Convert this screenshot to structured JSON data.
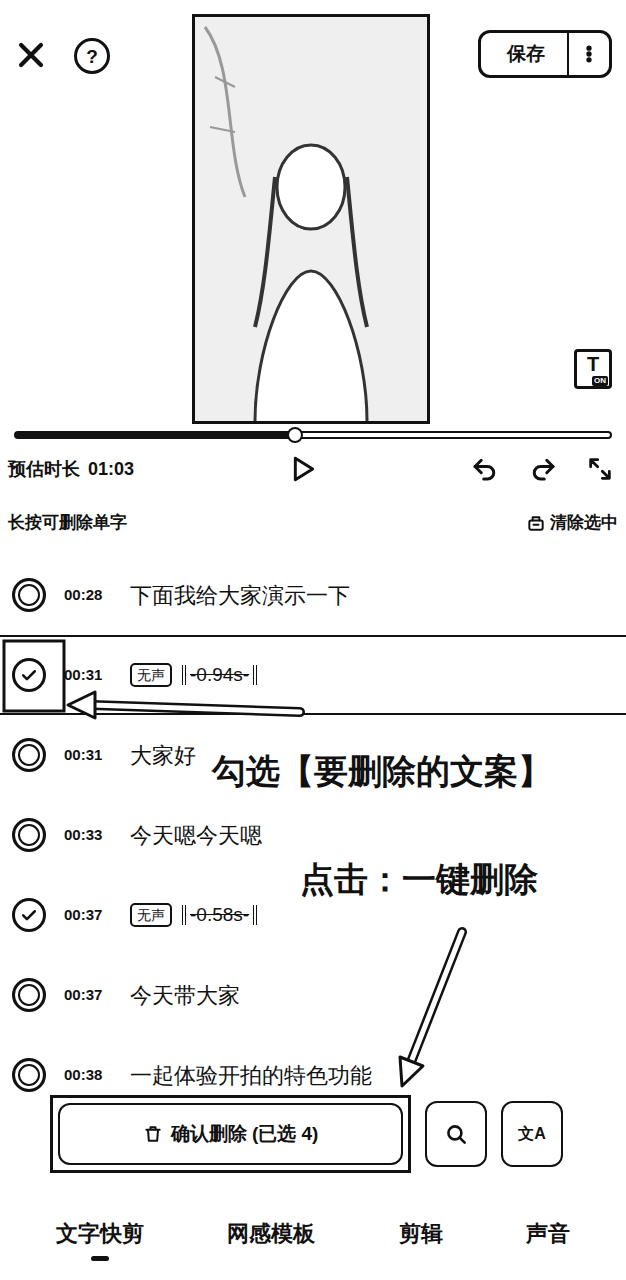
{
  "toolbar": {
    "help": "?",
    "save": "保存",
    "subtitle_toggle": {
      "letter": "T",
      "badge": "ON"
    }
  },
  "player": {
    "progress": 0.47,
    "estimate_label": "预估时长",
    "estimate_value": "01:03"
  },
  "hint": "长按可删除单字",
  "clear_selection": "清除选中",
  "segments": [
    {
      "time": "00:28",
      "kind": "speech",
      "text": "下面我给大家演示一下",
      "checked": false,
      "selected": false
    },
    {
      "time": "00:31",
      "kind": "silence",
      "tag": "无声",
      "text": "-0.94s-",
      "checked": true,
      "selected": true
    },
    {
      "time": "00:31",
      "kind": "speech",
      "text": "大家好",
      "checked": false,
      "selected": false
    },
    {
      "time": "00:33",
      "kind": "speech",
      "text": "今天嗯今天嗯",
      "checked": false,
      "selected": false
    },
    {
      "time": "00:37",
      "kind": "silence",
      "tag": "无声",
      "text": "-0.58s-",
      "checked": true,
      "selected": false
    },
    {
      "time": "00:37",
      "kind": "speech",
      "text": "今天带大家",
      "checked": false,
      "selected": false
    },
    {
      "time": "00:38",
      "kind": "speech",
      "text": "一起体验开拍的特色功能",
      "checked": false,
      "selected": false
    }
  ],
  "actions": {
    "confirm": "确认删除 (已选 4)",
    "translate": "文A"
  },
  "tabs": [
    {
      "label": "文字快剪",
      "selected": true
    },
    {
      "label": "网感模板",
      "selected": false
    },
    {
      "label": "剪辑",
      "selected": false
    },
    {
      "label": "声音",
      "selected": false
    }
  ],
  "annotations": [
    "勾选【要删除的文案】",
    "点击：一键删除"
  ]
}
